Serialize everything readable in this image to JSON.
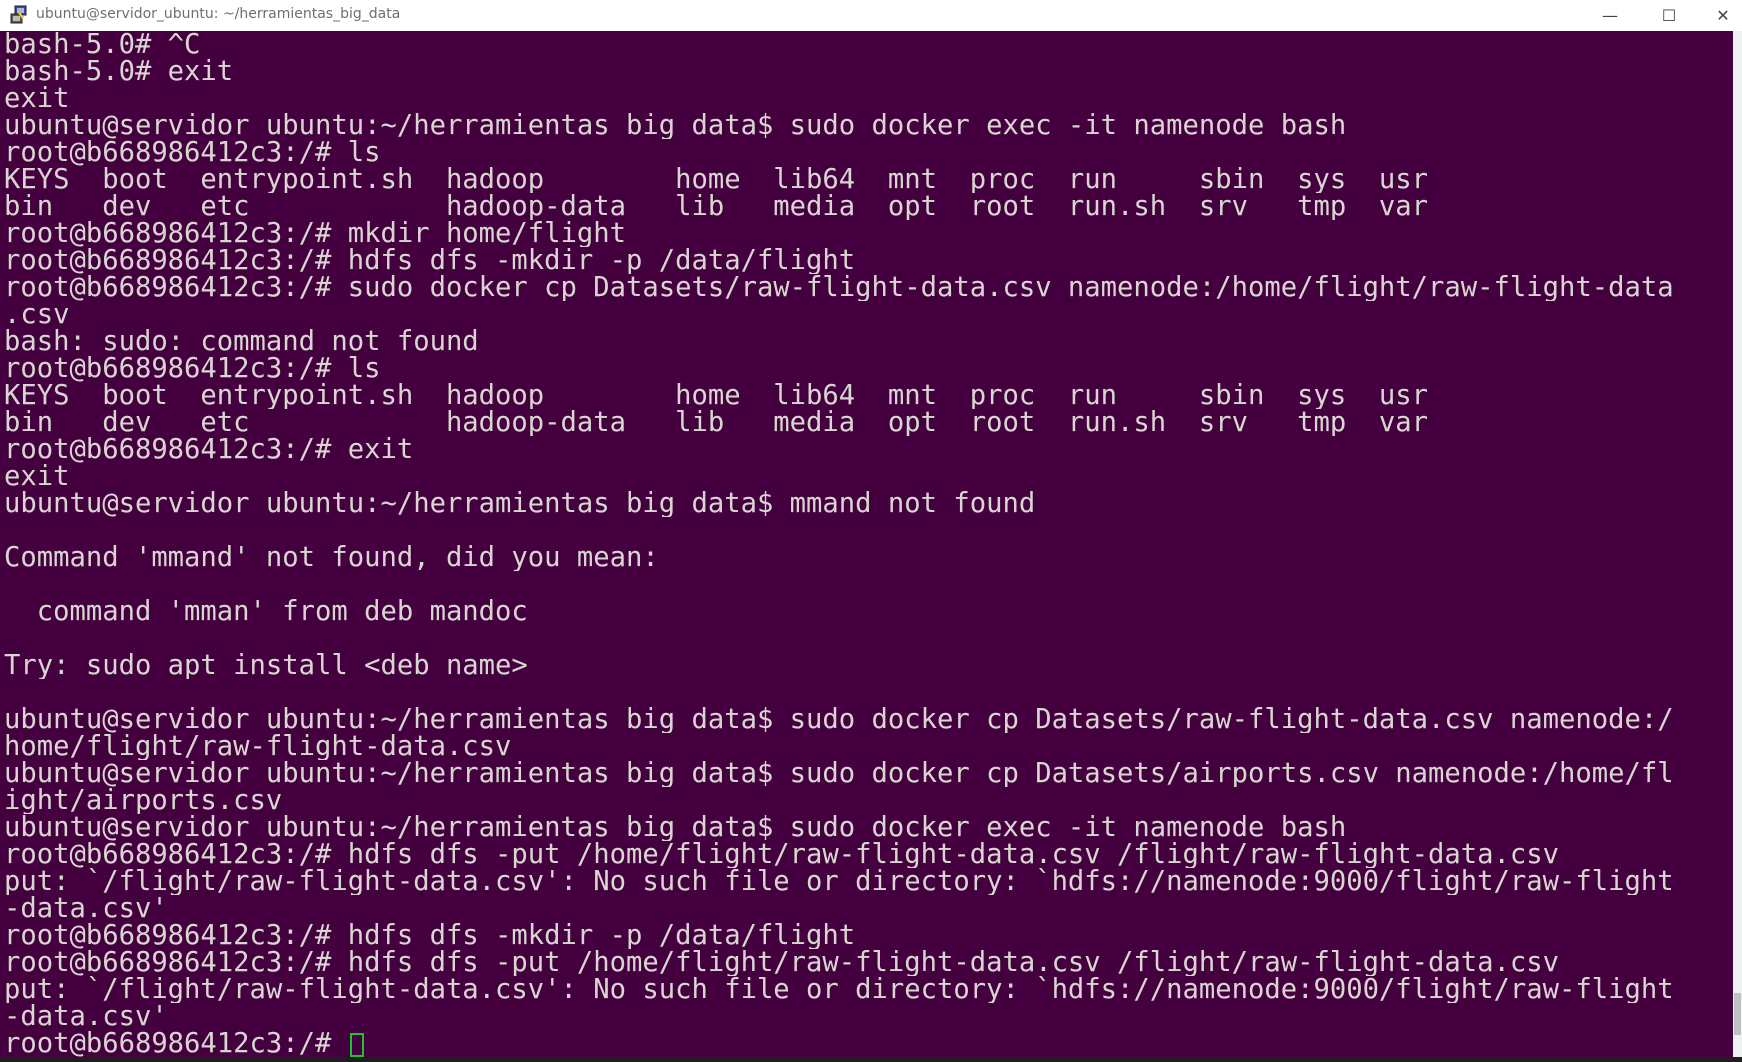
{
  "window": {
    "title": "ubuntu@servidor_ubuntu: ~/herramientas_big_data",
    "icon": "putty-icon",
    "controls": {
      "minimize": "—",
      "maximize": "☐",
      "close": "✕"
    }
  },
  "colors": {
    "background": "#44003e",
    "text": "#d9d6d2",
    "cursor": "#22c22e"
  },
  "terminal": {
    "lines": [
      "bash-5.0# ^C",
      "bash-5.0# exit",
      "exit",
      "ubuntu@servidor_ubuntu:~/herramientas_big_data$ sudo docker exec -it namenode bash",
      "root@b668986412c3:/# ls",
      "KEYS  boot  entrypoint.sh  hadoop        home  lib64  mnt  proc  run     sbin  sys  usr",
      "bin   dev   etc            hadoop-data   lib   media  opt  root  run.sh  srv   tmp  var",
      "root@b668986412c3:/# mkdir home/flight",
      "root@b668986412c3:/# hdfs dfs -mkdir -p /data/flight",
      "root@b668986412c3:/# sudo docker cp Datasets/raw-flight-data.csv namenode:/home/flight/raw-flight-data",
      ".csv",
      "bash: sudo: command not found",
      "root@b668986412c3:/# ls",
      "KEYS  boot  entrypoint.sh  hadoop        home  lib64  mnt  proc  run     sbin  sys  usr",
      "bin   dev   etc            hadoop-data   lib   media  opt  root  run.sh  srv   tmp  var",
      "root@b668986412c3:/# exit",
      "exit",
      "ubuntu@servidor_ubuntu:~/herramientas_big_data$ mmand not found",
      "",
      "Command 'mmand' not found, did you mean:",
      "",
      "  command 'mman' from deb mandoc",
      "",
      "Try: sudo apt install <deb name>",
      "",
      "ubuntu@servidor_ubuntu:~/herramientas_big_data$ sudo docker cp Datasets/raw-flight-data.csv namenode:/",
      "home/flight/raw-flight-data.csv",
      "ubuntu@servidor_ubuntu:~/herramientas_big_data$ sudo docker cp Datasets/airports.csv namenode:/home/fl",
      "ight/airports.csv",
      "ubuntu@servidor_ubuntu:~/herramientas_big_data$ sudo docker exec -it namenode bash",
      "root@b668986412c3:/# hdfs dfs -put /home/flight/raw-flight-data.csv /flight/raw-flight-data.csv",
      "put: `/flight/raw-flight-data.csv': No such file or directory: `hdfs://namenode:9000/flight/raw-flight",
      "-data.csv'",
      "root@b668986412c3:/# hdfs dfs -mkdir -p /data/flight",
      "root@b668986412c3:/# hdfs dfs -put /home/flight/raw-flight-data.csv /flight/raw-flight-data.csv",
      "put: `/flight/raw-flight-data.csv': No such file or directory: `hdfs://namenode:9000/flight/raw-flight",
      "-data.csv'",
      "root@b668986412c3:/# "
    ]
  }
}
